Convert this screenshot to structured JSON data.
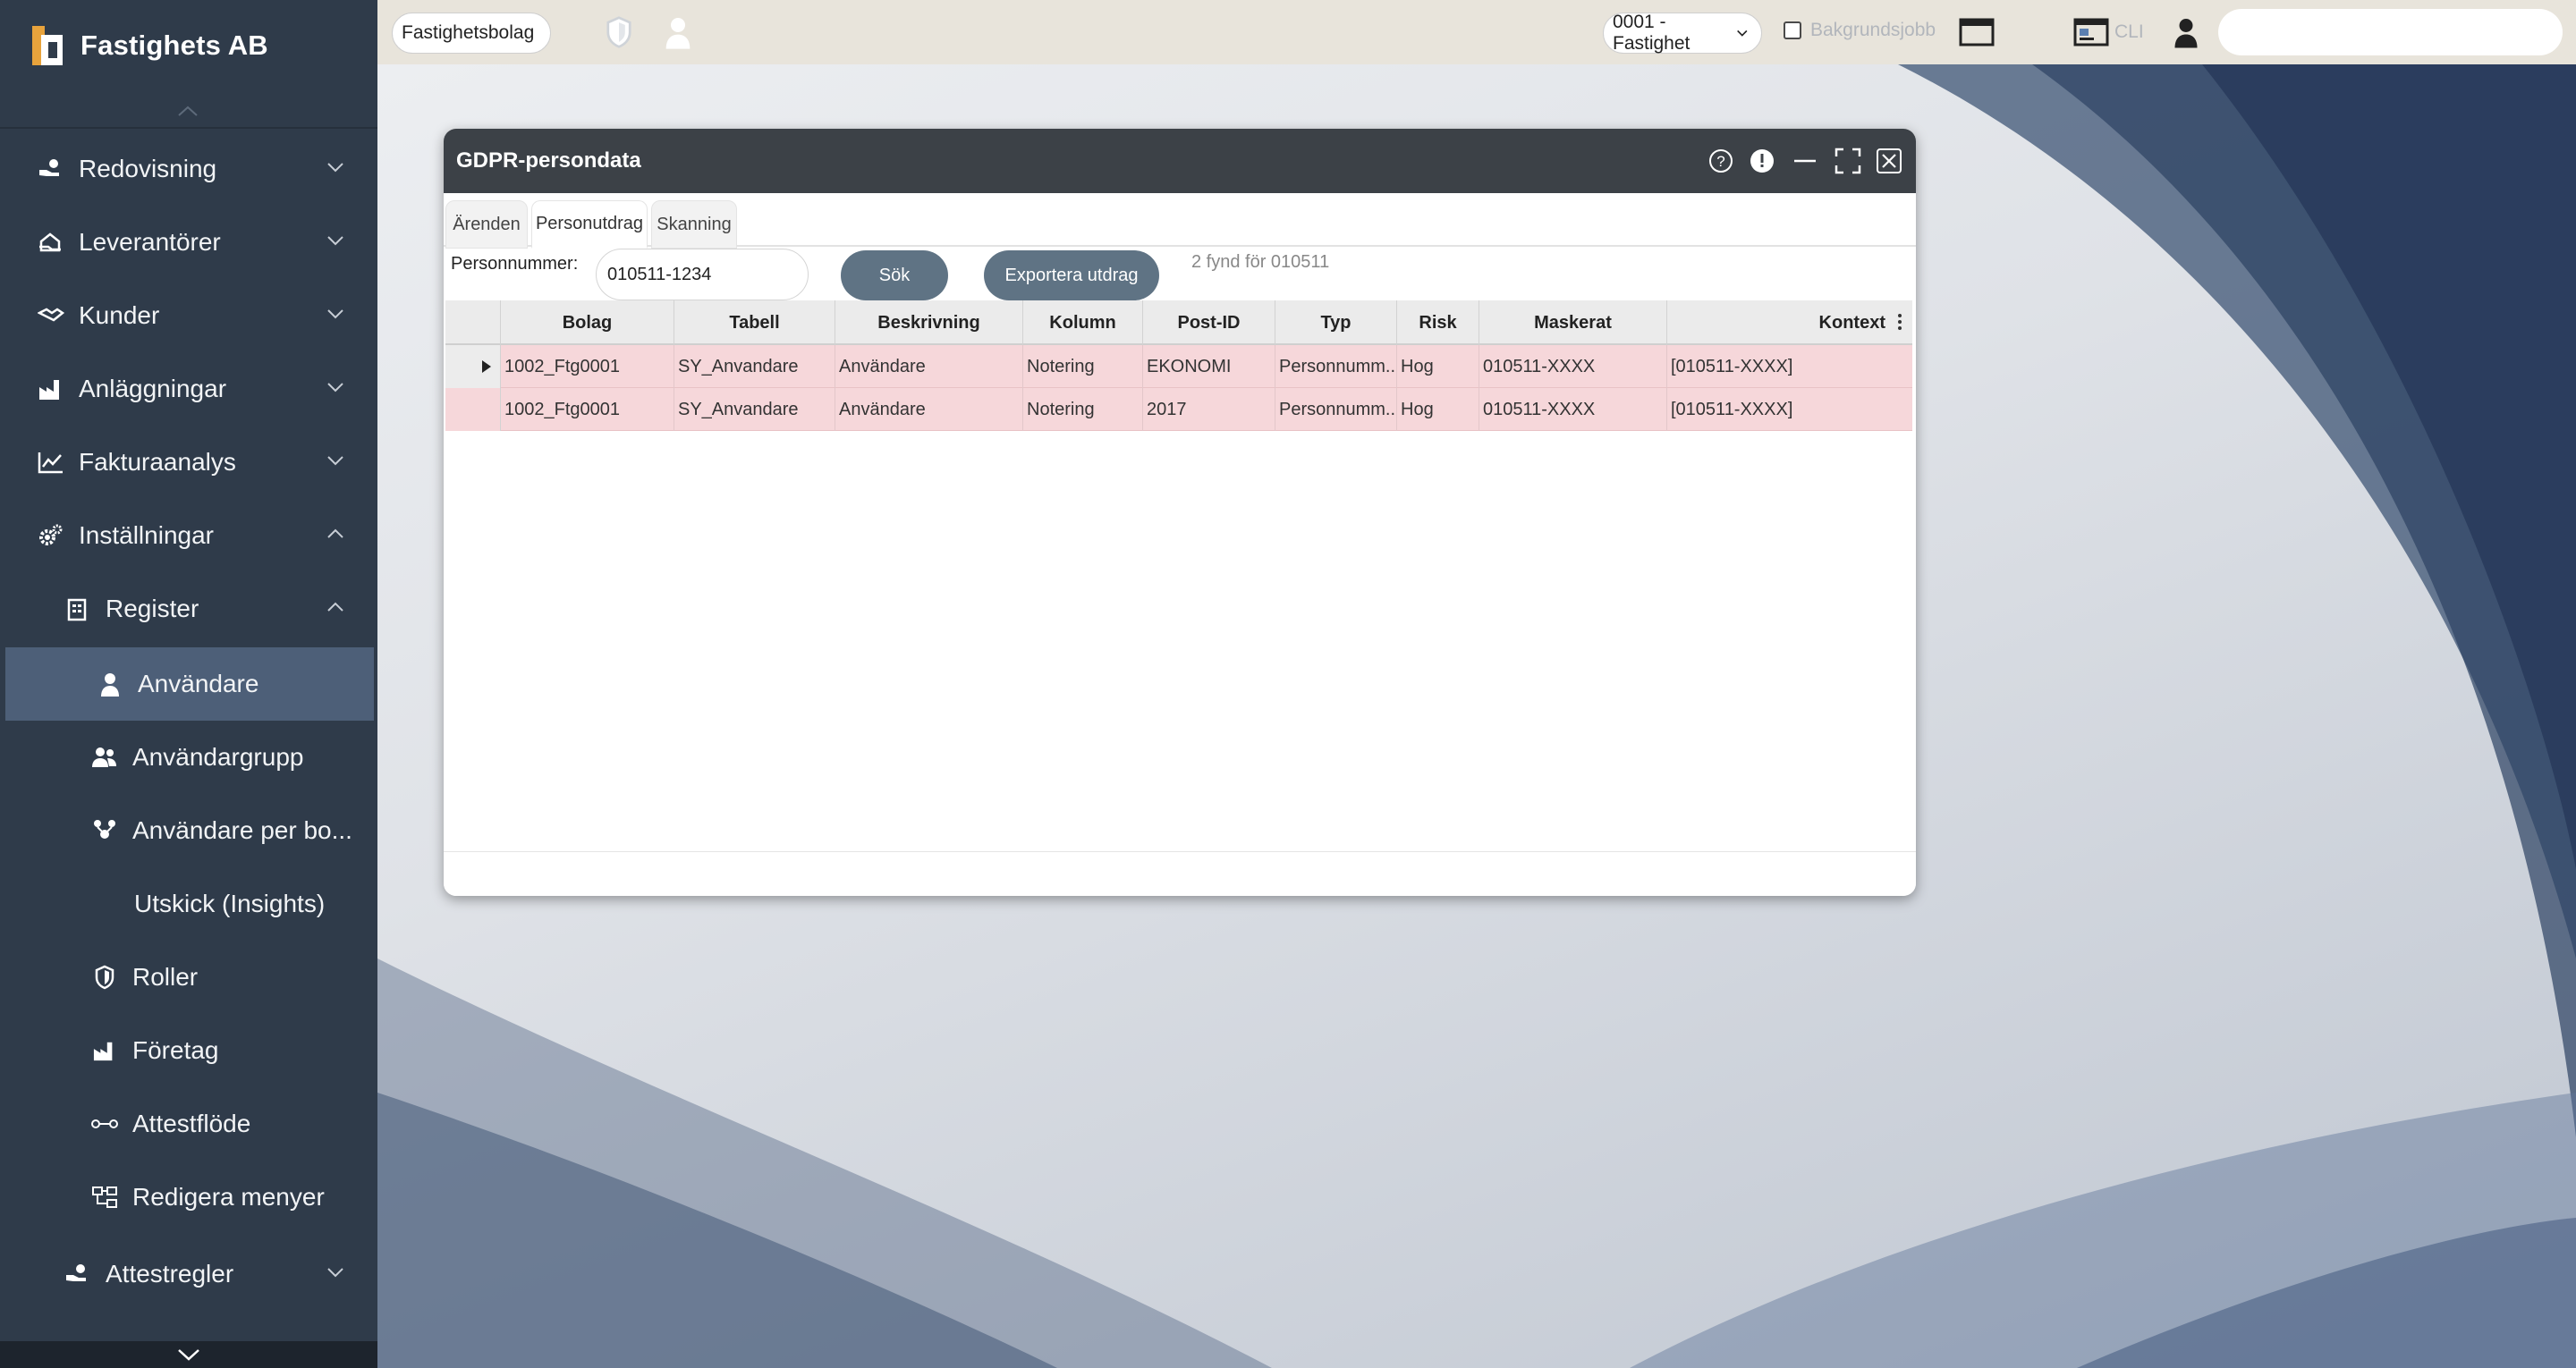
{
  "app": {
    "brand": "Fastighets AB",
    "colors": {
      "sidebar": "#2f3b4a",
      "active_item": "#4d5f78",
      "topbar": "#e8e4db",
      "accent_button": "#5f7384",
      "row_highlight": "#f6d7da",
      "logo_orange": "#e8a33c"
    }
  },
  "sidebar": {
    "items": [
      {
        "label": "Redovisning",
        "icon": "hand-coins-icon",
        "expanded": false
      },
      {
        "label": "Leverantörer",
        "icon": "supplier-icon",
        "expanded": false
      },
      {
        "label": "Kunder",
        "icon": "handshake-icon",
        "expanded": false
      },
      {
        "label": "Anläggningar",
        "icon": "factory-icon",
        "expanded": false
      },
      {
        "label": "Fakturaanalys",
        "icon": "line-chart-icon",
        "expanded": false
      },
      {
        "label": "Inställningar",
        "icon": "gears-icon",
        "expanded": true
      },
      {
        "label": "Register",
        "icon": "register-icon",
        "expanded": true
      },
      {
        "label": "Användare",
        "icon": "user-icon",
        "active": true
      },
      {
        "label": "Användargrupp",
        "icon": "users-icon"
      },
      {
        "label": "Användare per bo...",
        "icon": "users-network-icon"
      },
      {
        "label": "Utskick (Insights)",
        "icon": ""
      },
      {
        "label": "Roller",
        "icon": "shield-icon"
      },
      {
        "label": "Företag",
        "icon": "factory-icon"
      },
      {
        "label": "Attestflöde",
        "icon": "flow-icon"
      },
      {
        "label": "Redigera menyer",
        "icon": "sitemap-icon"
      },
      {
        "label": "Attestregler",
        "icon": "hand-coins-icon",
        "expanded": false
      }
    ]
  },
  "topbar": {
    "company_select": "Fastighetsbolag",
    "unit_select": "0001 - Fastighet",
    "background_jobs_label": "Bakgrundsjobb",
    "cli_label": "CLI",
    "search_placeholder": ""
  },
  "window": {
    "title": "GDPR-persondata",
    "tabs": [
      "Ärenden",
      "Personutdrag",
      "Skanning"
    ],
    "active_tab": "Personutdrag",
    "form": {
      "label": "Personnummer:",
      "value": "010511-1234",
      "search_button": "Sök",
      "export_button": "Exportera utdrag",
      "result_text": "2 fynd för 010511"
    },
    "grid": {
      "columns": [
        "Bolag",
        "Tabell",
        "Beskrivning",
        "Kolumn",
        "Post-ID",
        "Typ",
        "Risk",
        "Maskerat",
        "Kontext"
      ],
      "rows": [
        [
          "1002_Ftg0001",
          "SY_Anvandare",
          "Användare",
          "Notering",
          "EKONOMI",
          "Personnumm...",
          "Hog",
          "010511-XXXX",
          "[010511-XXXX]"
        ],
        [
          "1002_Ftg0001",
          "SY_Anvandare",
          "Användare",
          "Notering",
          "2017",
          "Personnumm...",
          "Hog",
          "010511-XXXX",
          "[010511-XXXX]"
        ]
      ]
    }
  }
}
